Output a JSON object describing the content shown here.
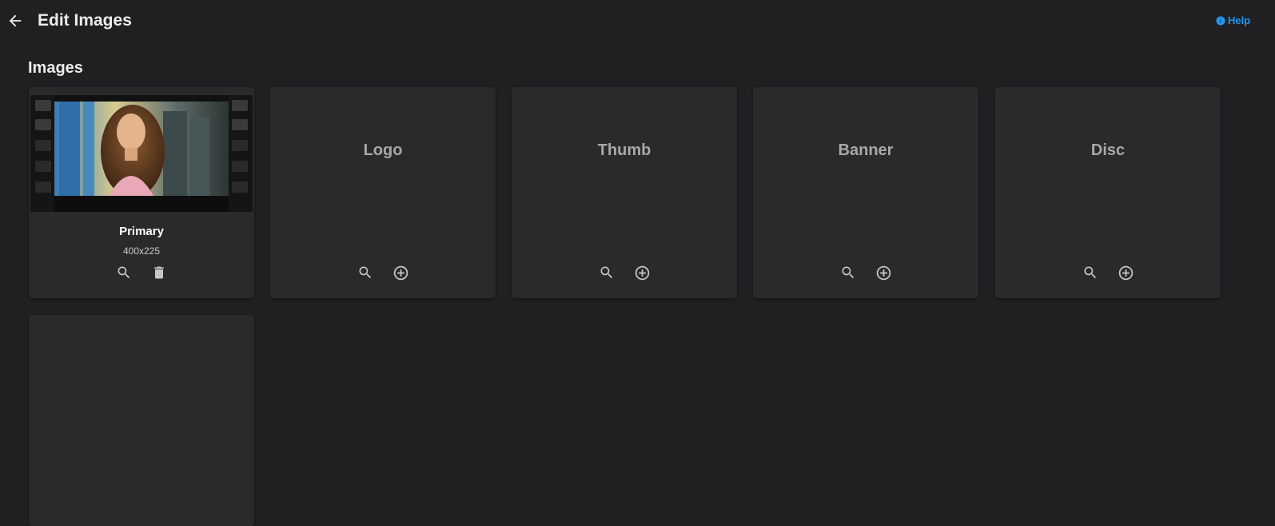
{
  "header": {
    "title": "Edit Images",
    "back_icon": "arrow-back-icon",
    "help_label": "Help",
    "help_icon": "info-icon",
    "help_color": "#2196f3"
  },
  "images_section": {
    "title": "Images",
    "cards": [
      {
        "name": "Primary",
        "dimensions": "400x225",
        "has_image": true,
        "image_description": "film-strip framed still of a woman with long brown hair in a school hallway",
        "actions": [
          "search-icon",
          "delete-icon"
        ]
      },
      {
        "name": "Logo",
        "has_image": false,
        "actions": [
          "search-icon",
          "add-circle-icon"
        ]
      },
      {
        "name": "Thumb",
        "has_image": false,
        "actions": [
          "search-icon",
          "add-circle-icon"
        ]
      },
      {
        "name": "Banner",
        "has_image": false,
        "actions": [
          "search-icon",
          "add-circle-icon"
        ]
      },
      {
        "name": "Disc",
        "has_image": false,
        "actions": [
          "search-icon",
          "add-circle-icon"
        ]
      },
      {
        "name": "",
        "has_image": false,
        "actions": []
      }
    ]
  },
  "colors": {
    "background": "#202023",
    "card": "#2a2a2d",
    "accent": "#2196f3"
  }
}
